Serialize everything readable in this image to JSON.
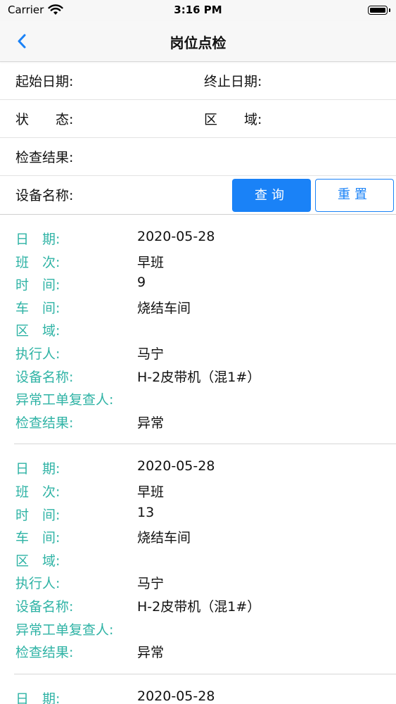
{
  "status_bar": {
    "carrier": "Carrier",
    "time": "3:16 PM",
    "icons": [
      "wifi-icon",
      "battery-icon"
    ]
  },
  "nav": {
    "title": "岗位点检",
    "back_icon": "chevron-left-icon"
  },
  "filters": {
    "start_date_label": "起始日期:",
    "end_date_label": "终止日期:",
    "status_label": "状　　态:",
    "area_label": "区　　域:",
    "result_label": "检查结果:",
    "device_label": "设备名称:",
    "query_button": "查询",
    "reset_button": "重置"
  },
  "colors": {
    "accent": "#1a82f7",
    "label_teal": "#2fb3a5"
  },
  "field_labels": {
    "date": "日　期:",
    "shift": "班　次:",
    "time": "时　间:",
    "workshop": "车　间:",
    "area": "区　域:",
    "executor": "执行人:",
    "device": "设备名称:",
    "reviewer": "异常工单复查人:",
    "result": "检查结果:"
  },
  "records": [
    {
      "date": "2020-05-28",
      "shift": "早班",
      "time": "9",
      "workshop": "烧结车间",
      "area": "",
      "executor": "马宁",
      "device": "H-2皮带机（混1#）",
      "reviewer": "",
      "result": "异常"
    },
    {
      "date": "2020-05-28",
      "shift": "早班",
      "time": "13",
      "workshop": "烧结车间",
      "area": "",
      "executor": "马宁",
      "device": "H-2皮带机（混1#）",
      "reviewer": "",
      "result": "异常"
    },
    {
      "date": "2020-05-28"
    }
  ]
}
